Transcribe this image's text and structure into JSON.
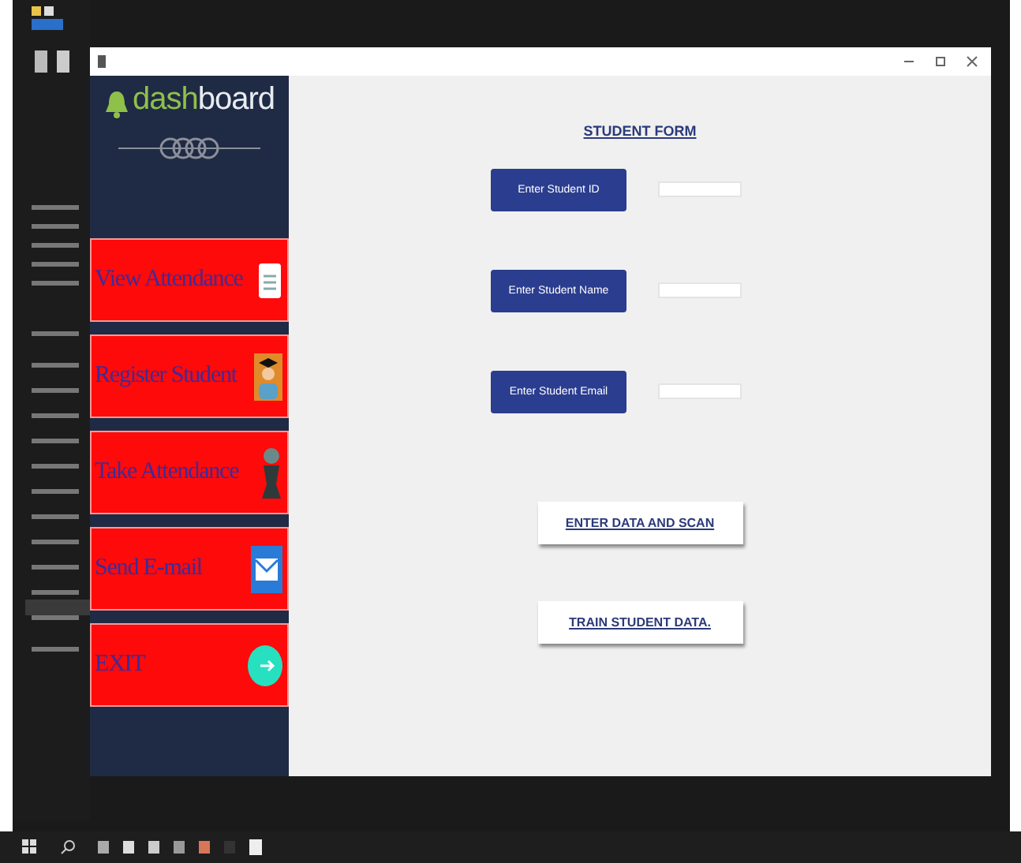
{
  "sidebar": {
    "logo": {
      "part_1": "dash",
      "part_2": "board"
    },
    "items": [
      {
        "label": "View Attendance",
        "kind": "document"
      },
      {
        "label": "Register Student",
        "kind": "student"
      },
      {
        "label": "Take Attendance",
        "kind": "person"
      },
      {
        "label": "Send E-mail",
        "kind": "mail"
      },
      {
        "label": "EXIT",
        "kind": "exit"
      }
    ]
  },
  "form": {
    "title": "STUDENT FORM",
    "fields": [
      {
        "label": "Enter Student ID"
      },
      {
        "label": "Enter Student Name"
      },
      {
        "label": "Enter Student Email"
      }
    ],
    "actions": [
      "ENTER DATA AND SCAN",
      "TRAIN STUDENT DATA."
    ]
  }
}
